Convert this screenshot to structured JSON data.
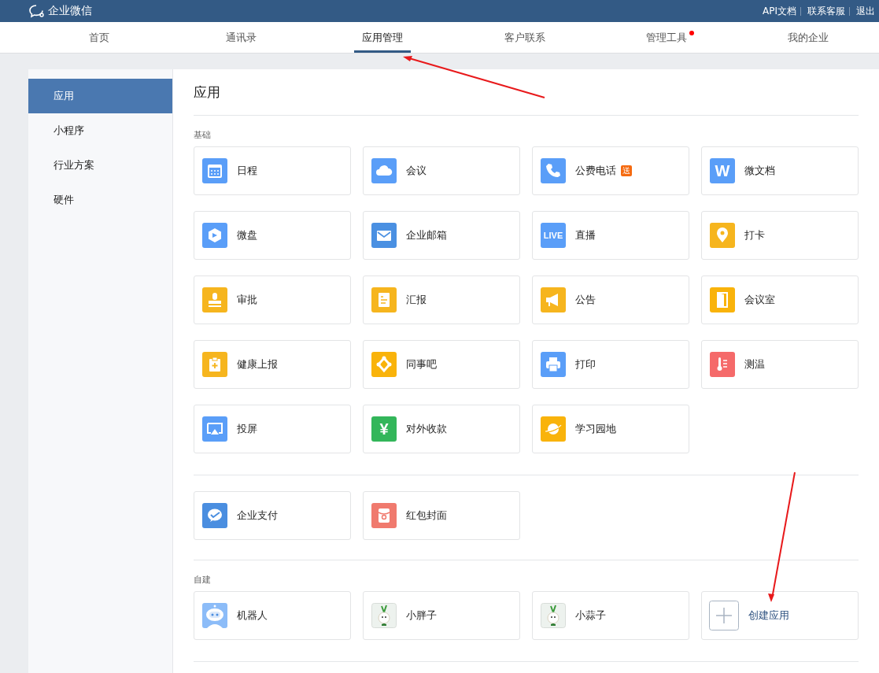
{
  "top_bar": {
    "logo": "企业微信",
    "links": [
      "API文档",
      "联系客服",
      "退出"
    ]
  },
  "nav": [
    {
      "label": "首页",
      "selected": false,
      "dot": false
    },
    {
      "label": "通讯录",
      "selected": false,
      "dot": false
    },
    {
      "label": "应用管理",
      "selected": true,
      "dot": false
    },
    {
      "label": "客户联系",
      "selected": false,
      "dot": false
    },
    {
      "label": "管理工具",
      "selected": false,
      "dot": true
    },
    {
      "label": "我的企业",
      "selected": false,
      "dot": false
    }
  ],
  "sidebar": {
    "items": [
      {
        "label": "应用",
        "selected": true
      },
      {
        "label": "小程序",
        "selected": false
      },
      {
        "label": "行业方案",
        "selected": false
      },
      {
        "label": "硬件",
        "selected": false
      }
    ]
  },
  "main": {
    "title": "应用",
    "sections": [
      {
        "heading": "基础",
        "apps": [
          {
            "name": "日程",
            "kind": "app",
            "color": "#5a9ef8"
          },
          {
            "name": "会议",
            "kind": "app",
            "color": "#5a9ef8"
          },
          {
            "name": "公费电话",
            "kind": "app",
            "color": "#5a9ef8",
            "badge": "送"
          },
          {
            "name": "微文档",
            "kind": "app",
            "color": "#5a9ef8",
            "icon_text": "W"
          },
          {
            "name": "微盘",
            "kind": "app",
            "color": "#5a9ef8"
          },
          {
            "name": "企业邮箱",
            "kind": "app",
            "color": "#4a90e2"
          },
          {
            "name": "直播",
            "kind": "app",
            "color": "#5a9ef8",
            "icon_text": "LIVE"
          },
          {
            "name": "打卡",
            "kind": "app",
            "color": "#f6b51e"
          },
          {
            "name": "审批",
            "kind": "app",
            "color": "#f6b51e"
          },
          {
            "name": "汇报",
            "kind": "app",
            "color": "#f6b51e"
          },
          {
            "name": "公告",
            "kind": "app",
            "color": "#f6b51e"
          },
          {
            "name": "会议室",
            "kind": "app",
            "color": "#f9b30b"
          },
          {
            "name": "健康上报",
            "kind": "app",
            "color": "#f6b51e"
          },
          {
            "name": "同事吧",
            "kind": "app",
            "color": "#f9b30b"
          },
          {
            "name": "打印",
            "kind": "app",
            "color": "#5a9ef8"
          },
          {
            "name": "测温",
            "kind": "app",
            "color": "#f56a6a"
          },
          {
            "name": "投屏",
            "kind": "app",
            "color": "#5a9ef8"
          },
          {
            "name": "对外收款",
            "kind": "app",
            "color": "#33b65a",
            "icon_text": "¥"
          },
          {
            "name": "学习园地",
            "kind": "app",
            "color": "#f9b30b"
          }
        ]
      },
      {
        "apps": [
          {
            "name": "企业支付",
            "kind": "app",
            "color": "#4a8ee0"
          },
          {
            "name": "红包封面",
            "kind": "app",
            "color": "#f07a6e"
          }
        ]
      },
      {
        "heading": "自建",
        "apps": [
          {
            "name": "机器人",
            "kind": "robot"
          },
          {
            "name": "小胖子",
            "kind": "mascot"
          },
          {
            "name": "小蒜子",
            "kind": "mascot"
          },
          {
            "name": "创建应用",
            "kind": "create"
          }
        ]
      }
    ]
  }
}
